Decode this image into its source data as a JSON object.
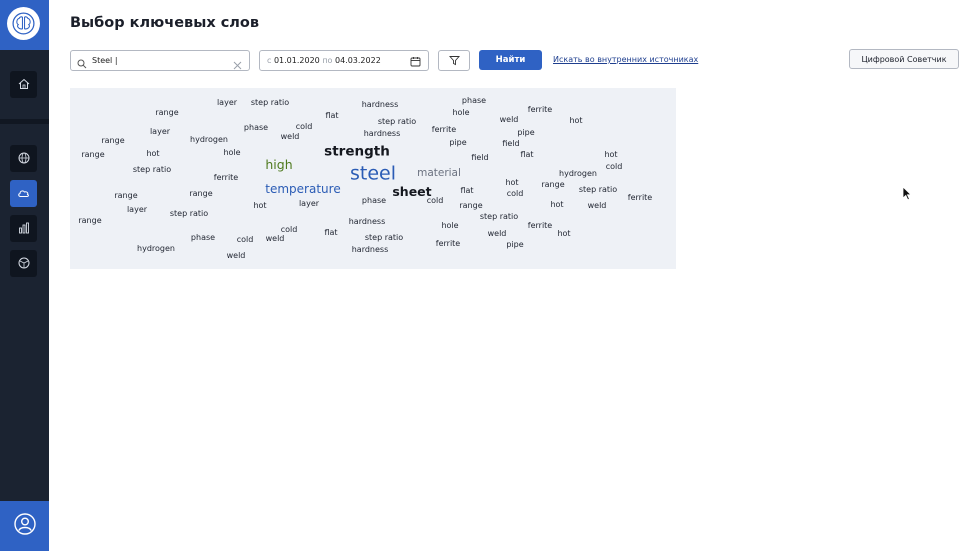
{
  "page": {
    "title": "Выбор ключевых слов"
  },
  "sidebar": {
    "items": [
      {
        "icon": "home-icon"
      },
      {
        "icon": "globe-icon"
      },
      {
        "icon": "cloud-icon",
        "active": true
      },
      {
        "icon": "bar-chart-icon"
      },
      {
        "icon": "network-icon"
      }
    ],
    "user_icon": "user-icon"
  },
  "search": {
    "value": "Steel |",
    "placeholder": ""
  },
  "date_range": {
    "from_prefix": "с",
    "from": "01.01.2020",
    "to_prefix": "по",
    "to": "04.03.2022"
  },
  "toolbar": {
    "find_label": "Найти",
    "internal_link": "Искать во внутренних источниках",
    "advisor_label": "Цифровой Советчик"
  },
  "colors": {
    "accent": "#2f62c4",
    "sidebar": "#1b2331",
    "panel": "#eef1f6",
    "word_blue": "#2b5cb5",
    "word_green": "#4f7a1f",
    "word_gray": "#6b7280"
  },
  "word_cloud": {
    "words": [
      {
        "text": "layer"
      },
      {
        "text": "step ratio"
      },
      {
        "text": "hardness"
      },
      {
        "text": "phase"
      },
      {
        "text": "range"
      },
      {
        "text": "flat"
      },
      {
        "text": "hole"
      },
      {
        "text": "ferrite"
      },
      {
        "text": "step ratio"
      },
      {
        "text": "weld"
      },
      {
        "text": "hot"
      },
      {
        "text": "layer"
      },
      {
        "text": "phase"
      },
      {
        "text": "cold"
      },
      {
        "text": "hardness"
      },
      {
        "text": "ferrite"
      },
      {
        "text": "pipe"
      },
      {
        "text": "range"
      },
      {
        "text": "hydrogen"
      },
      {
        "text": "weld"
      },
      {
        "text": "pipe"
      },
      {
        "text": "field"
      },
      {
        "text": "range"
      },
      {
        "text": "hot"
      },
      {
        "text": "hole"
      },
      {
        "text": "strength"
      },
      {
        "text": "field"
      },
      {
        "text": "flat"
      },
      {
        "text": "hot"
      },
      {
        "text": "high"
      },
      {
        "text": "cold"
      },
      {
        "text": "step ratio"
      },
      {
        "text": "steel"
      },
      {
        "text": "material"
      },
      {
        "text": "hydrogen"
      },
      {
        "text": "ferrite"
      },
      {
        "text": "hot"
      },
      {
        "text": "temperature"
      },
      {
        "text": "range"
      },
      {
        "text": "sheet"
      },
      {
        "text": "flat"
      },
      {
        "text": "cold"
      },
      {
        "text": "step ratio"
      },
      {
        "text": "range"
      },
      {
        "text": "range"
      },
      {
        "text": "phase"
      },
      {
        "text": "cold"
      },
      {
        "text": "ferrite"
      },
      {
        "text": "hot"
      },
      {
        "text": "layer"
      },
      {
        "text": "range"
      },
      {
        "text": "hot"
      },
      {
        "text": "weld"
      },
      {
        "text": "layer"
      },
      {
        "text": "step ratio"
      },
      {
        "text": "step ratio"
      },
      {
        "text": "range"
      },
      {
        "text": "hardness"
      },
      {
        "text": "hole"
      },
      {
        "text": "ferrite"
      },
      {
        "text": "cold"
      },
      {
        "text": "flat"
      },
      {
        "text": "weld"
      },
      {
        "text": "hot"
      },
      {
        "text": "phase"
      },
      {
        "text": "cold"
      },
      {
        "text": "weld"
      },
      {
        "text": "step ratio"
      },
      {
        "text": "ferrite"
      },
      {
        "text": "pipe"
      },
      {
        "text": "hydrogen"
      },
      {
        "text": "hardness"
      },
      {
        "text": "weld"
      }
    ]
  }
}
